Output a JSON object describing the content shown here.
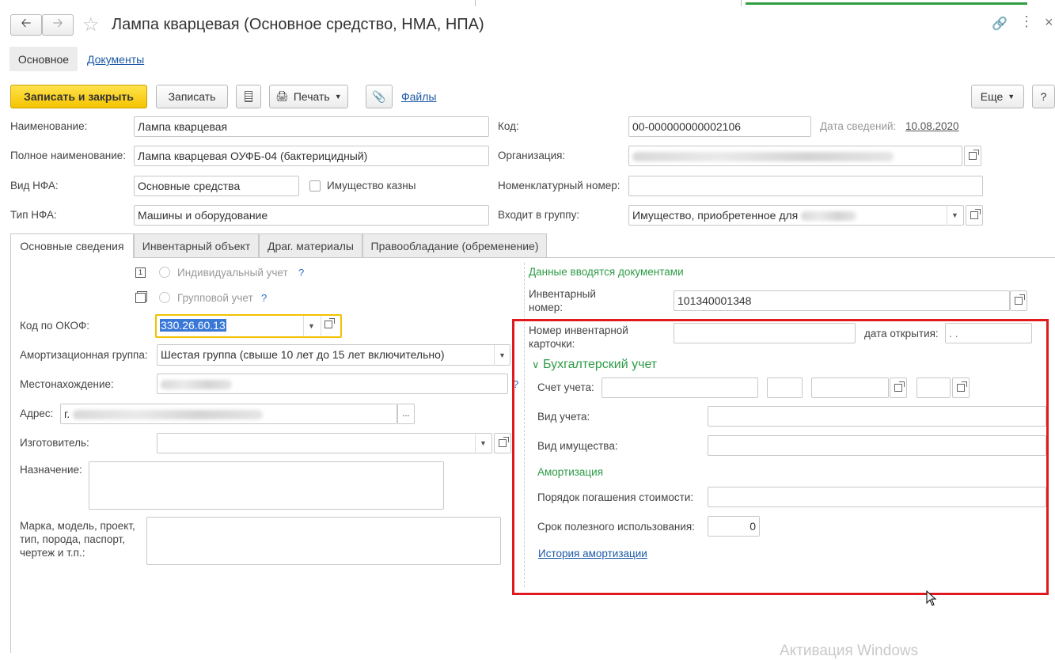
{
  "window": {
    "title": "Лампа кварцевая (Основное средство, НМА, НПА)",
    "nav_tabs": [
      "Основное",
      "Документы"
    ]
  },
  "toolbar": {
    "save_close": "Записать и закрыть",
    "save": "Записать",
    "print": "Печать",
    "files": "Файлы",
    "more": "Еще",
    "help": "?"
  },
  "header": {
    "name_label": "Наименование:",
    "name_value": "Лампа кварцевая",
    "full_name_label": "Полное наименование:",
    "full_name_value": "Лампа кварцевая ОУФБ-04 (бактерицидный)",
    "nfa_kind_label": "Вид НФА:",
    "nfa_kind_value": "Основные средства",
    "treasury_label": "Имущество казны",
    "nfa_type_label": "Тип НФА:",
    "nfa_type_value": "Машины и оборудование",
    "code_label": "Код:",
    "code_value": "00-000000000002106",
    "info_date_label": "Дата сведений:",
    "info_date_value": "10.08.2020",
    "org_label": "Организация:",
    "nomen_label": "Номенклатурный номер:",
    "group_label": "Входит в группу:",
    "group_value": "Имущество, приобретенное для"
  },
  "tabs": [
    "Основные сведения",
    "Инвентарный объект",
    "Драг. материалы",
    "Правообладание (обременение)"
  ],
  "left": {
    "individual": "Индивидуальный учет",
    "group": "Групповой учет",
    "okof_label": "Код по ОКОФ:",
    "okof_value": "330.26.60.13",
    "amort_group_label": "Амортизационная группа:",
    "amort_group_value": "Шестая группа (свыше 10 лет до 15 лет включительно)",
    "location_label": "Местонахождение:",
    "address_label": "Адрес:",
    "address_prefix": "г.",
    "maker_label": "Изготовитель:",
    "purpose_label": "Назначение:",
    "model_label_1": "Марка, модель, проект,",
    "model_label_2": "тип, порода, паспорт,",
    "model_label_3": "чертеж и т.п.:",
    "ellipsis": "..."
  },
  "right": {
    "docs_note": "Данные вводятся документами",
    "inv_num_label_1": "Инвентарный",
    "inv_num_label_2": "номер:",
    "inv_num_value": "101340001348",
    "card_label_1": "Номер инвентарной",
    "card_label_2": "карточки:",
    "open_date_label": "дата открытия:",
    "open_date_value": ". .",
    "accounting_header": "Бухгалтерский учет",
    "account_label": "Счет учета:",
    "acc_kind_label": "Вид учета:",
    "property_kind_label": "Вид имущества:",
    "amort_header": "Амортизация",
    "repay_label": "Порядок погашения стоимости:",
    "useful_life_label": "Срок полезного использования:",
    "useful_life_value": "0",
    "history_link": "История амортизации"
  },
  "watermark": "Активация Windows",
  "colors": {
    "primary_button": "#f5c400",
    "highlight_box": "#e0191e",
    "link": "#1c59a6",
    "green_text": "#2e9b47"
  }
}
